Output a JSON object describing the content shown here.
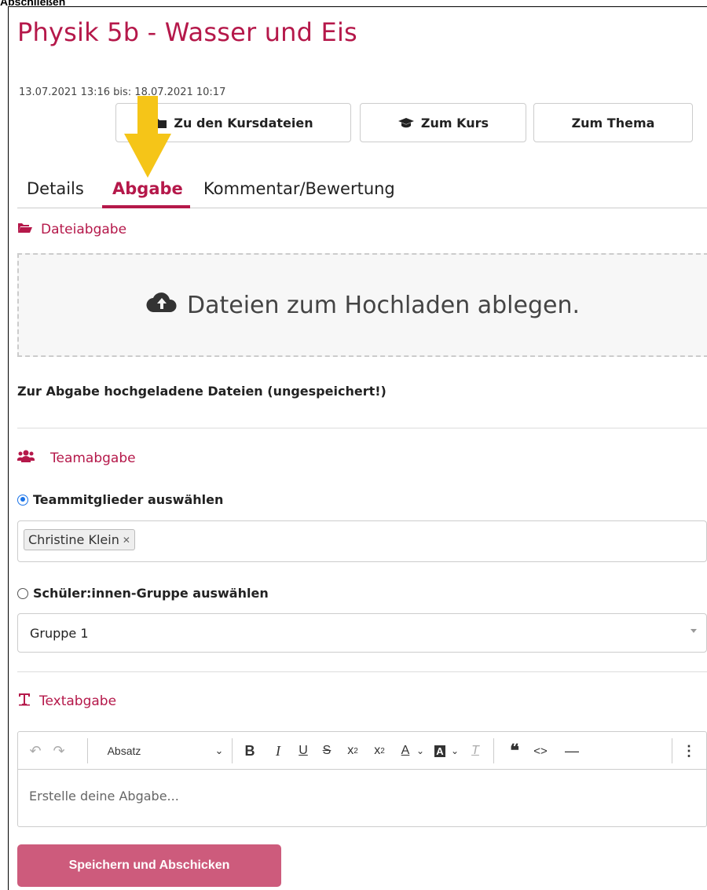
{
  "window": {
    "caption": "Abschließen"
  },
  "assignment": {
    "title": "Physik 5b - Wasser und Eis",
    "date_range": "13.07.2021 13:16 bis: 18.07.2021 10:17"
  },
  "header_buttons": {
    "kursdateien": "Zu den Kursdateien",
    "kurs": "Zum Kurs",
    "thema": "Zum Thema"
  },
  "tabs": [
    {
      "label": "Details",
      "active": false
    },
    {
      "label": "Abgabe",
      "active": true
    },
    {
      "label": "Kommentar/Bewertung",
      "active": false
    }
  ],
  "file_submission": {
    "heading": "Dateiabgabe",
    "dropzone_text": "Dateien zum Hochladen ablegen.",
    "uploaded_label": "Zur Abgabe hochgeladene Dateien (ungespeichert!)"
  },
  "team_submission": {
    "heading": "Teamabgabe",
    "option_members": {
      "label": "Teammitglieder auswählen",
      "selected": true
    },
    "selected_members": [
      "Christine Klein"
    ],
    "option_group": {
      "label": "Schüler:innen-Gruppe auswählen",
      "selected": false
    },
    "group_select_value": "Gruppe 1"
  },
  "text_submission": {
    "heading": "Textabgabe",
    "paragraph_format": "Absatz",
    "placeholder": "Erstelle deine Abgabe..."
  },
  "submit_label": "Speichern und Abschicken",
  "colors": {
    "accent": "#b5184a",
    "submit_button": "#cd5b7c",
    "annotation_arrow": "#f5c518",
    "radio_checked": "#1a73e8"
  },
  "icons": {
    "kursdateien": "folder-icon",
    "kurs": "graduation-cap-icon",
    "dateiabgabe": "folder-open-icon",
    "dropzone": "cloud-upload-icon",
    "teamabgabe": "users-icon",
    "textabgabe": "text-icon"
  }
}
